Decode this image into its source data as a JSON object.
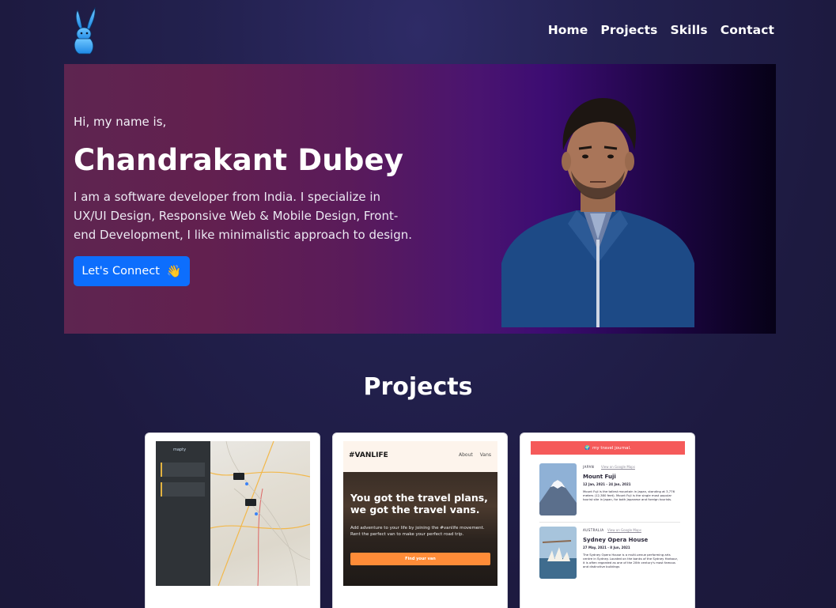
{
  "nav": {
    "logo_icon": "rabbit-logo-icon",
    "links": [
      "Home",
      "Projects",
      "Skills",
      "Contact"
    ]
  },
  "hero": {
    "greeting": "Hi, my name is,",
    "name": "Chandrakant Dubey",
    "bio": "I am a software developer from India. I specialize in UX/UI Design, Responsive Web & Mobile Design, Front-end Development, I like minimalistic approach to design.",
    "cta_label": "Let's Connect",
    "cta_icon": "waving-hand-icon",
    "cta_color": "#0d6efd"
  },
  "projects": {
    "title": "Projects",
    "map_card": {
      "brand": "mapty"
    },
    "vanlife_card": {
      "logo": "#VANLIFE",
      "links": [
        "About",
        "Vans"
      ],
      "headline": "You got the travel plans, we got the travel vans.",
      "subtext": "Add adventure to your life by joining the #vanlife movement. Rent the perfect van to make your perfect road trip.",
      "button": "Find your van",
      "accent": "#ff8c38"
    },
    "journal_card": {
      "header": "my travel journal.",
      "accent": "#f55a5a",
      "entries": [
        {
          "country": "JAPAN",
          "maps_link": "View on Google Maps",
          "title": "Mount Fuji",
          "dates": "12 Jan, 2021 - 24 Jan, 2021",
          "description": "Mount Fuji is the tallest mountain in Japan, standing at 3,776 meters (12,380 feet). Mount Fuji is the single most popular tourist site in Japan, for both Japanese and foreign tourists."
        },
        {
          "country": "AUSTRALIA",
          "maps_link": "View on Google Maps",
          "title": "Sydney Opera House",
          "dates": "27 May, 2021 - 8 Jun, 2021",
          "description": "The Sydney Opera House is a multi-venue performing arts centre in Sydney. Located on the banks of the Sydney Harbour, it is often regarded as one of the 20th century's most famous and distinctive buildings"
        }
      ]
    }
  }
}
